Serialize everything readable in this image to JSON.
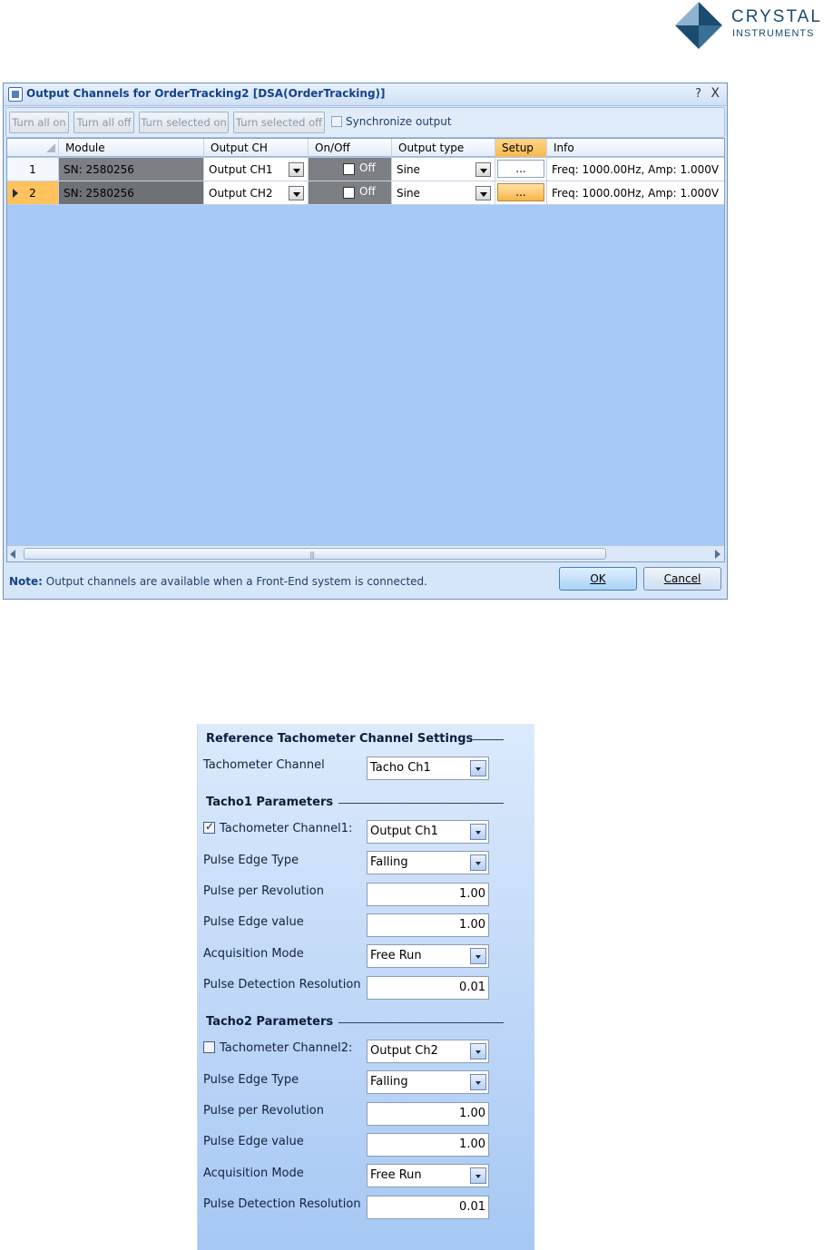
{
  "logo": {
    "line1": "CRYSTAL",
    "line2": "INSTRUMENTS"
  },
  "dialog": {
    "title": "Output Channels for OrderTracking2 [DSA(OrderTracking)]",
    "help": "?",
    "close": "X",
    "toolbar": {
      "turn_all_on": "Turn all on",
      "turn_all_off": "Turn all off",
      "turn_selected_on": "Turn selected on",
      "turn_selected_off": "Turn selected off",
      "synchronize": "Synchronize output"
    },
    "columns": [
      "Module",
      "Output CH",
      "On/Off",
      "Output type",
      "Setup",
      "Info"
    ],
    "rows": [
      {
        "num": "1",
        "module": "SN: 2580256",
        "output_ch": "Output CH1",
        "onoff": "Off",
        "output_type": "Sine",
        "setup": "...",
        "info": "Freq: 1000.00Hz, Amp: 1.000V"
      },
      {
        "num": "2",
        "module": "SN: 2580256",
        "output_ch": "Output CH2",
        "onoff": "Off",
        "output_type": "Sine",
        "setup": "...",
        "info": "Freq: 1000.00Hz, Amp: 1.000V"
      }
    ],
    "note_label": "Note:",
    "note_text": " Output channels are available when a Front-End system is connected.",
    "ok": "OK",
    "cancel": "Cancel"
  },
  "tacho": {
    "ref_title": "Reference Tachometer Channel Settings",
    "tacho_channel_label": "Tachometer Channel",
    "tacho_channel_value": "Tacho Ch1",
    "t1": {
      "title": "Tacho1 Parameters",
      "channel_label": "Tachometer Channel1:",
      "channel_checked": true,
      "channel_value": "Output Ch1",
      "edge_type_label": "Pulse Edge Type",
      "edge_type_value": "Falling",
      "ppr_label": "Pulse per Revolution",
      "ppr_value": "1.00",
      "edge_value_label": "Pulse Edge value",
      "edge_value_value": "1.00",
      "acq_label": "Acquisition Mode",
      "acq_value": "Free Run",
      "res_label": "Pulse Detection Resolution",
      "res_value": "0.01"
    },
    "t2": {
      "title": "Tacho2 Parameters",
      "channel_label": "Tachometer Channel2:",
      "channel_checked": false,
      "channel_value": "Output Ch2",
      "edge_type_label": "Pulse Edge Type",
      "edge_type_value": "Falling",
      "ppr_label": "Pulse per Revolution",
      "ppr_value": "1.00",
      "edge_value_label": "Pulse Edge value",
      "edge_value_value": "1.00",
      "acq_label": "Acquisition Mode",
      "acq_value": "Free Run",
      "res_label": "Pulse Detection Resolution",
      "res_value": "0.01"
    }
  }
}
